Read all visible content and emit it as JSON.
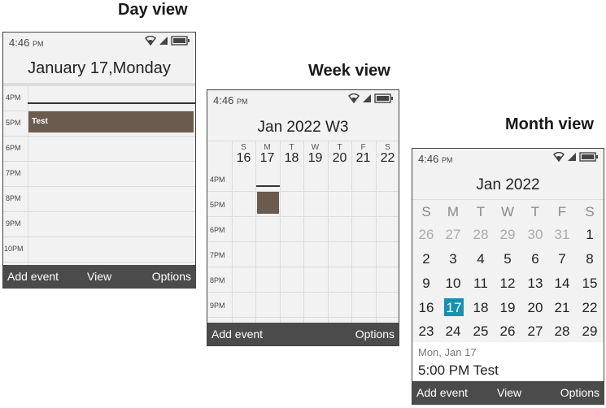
{
  "headings": {
    "day": "Day view",
    "week": "Week view",
    "month": "Month view"
  },
  "status": {
    "time": "4:46",
    "ampm": "PM"
  },
  "softkeys": {
    "add_event": "Add event",
    "view": "View",
    "options": "Options"
  },
  "day_view": {
    "title": "January 17,Monday",
    "hours": [
      "4PM",
      "5PM",
      "6PM",
      "7PM",
      "8PM",
      "9PM",
      "10PM"
    ],
    "event": {
      "title": "Test"
    }
  },
  "week_view": {
    "title": "Jan 2022 W3",
    "days": [
      {
        "letter": "S",
        "num": "16"
      },
      {
        "letter": "M",
        "num": "17"
      },
      {
        "letter": "T",
        "num": "18"
      },
      {
        "letter": "W",
        "num": "19"
      },
      {
        "letter": "T",
        "num": "20"
      },
      {
        "letter": "F",
        "num": "21"
      },
      {
        "letter": "S",
        "num": "22"
      }
    ],
    "hours": [
      "4PM",
      "5PM",
      "6PM",
      "7PM",
      "8PM",
      "9PM"
    ]
  },
  "month_view": {
    "title": "Jan 2022",
    "weekdays": [
      "S",
      "M",
      "T",
      "W",
      "T",
      "F",
      "S"
    ],
    "weeks": [
      [
        "26",
        "27",
        "28",
        "29",
        "30",
        "31",
        "1"
      ],
      [
        "2",
        "3",
        "4",
        "5",
        "6",
        "7",
        "8"
      ],
      [
        "9",
        "10",
        "11",
        "12",
        "13",
        "14",
        "15"
      ],
      [
        "16",
        "17",
        "18",
        "19",
        "20",
        "21",
        "22"
      ],
      [
        "23",
        "24",
        "25",
        "26",
        "27",
        "28",
        "29"
      ]
    ],
    "selected_date_label": "Mon, Jan 17",
    "agenda_item": "5:00 PM Test"
  },
  "colors": {
    "event": "#6b5b4f",
    "today": "#1691b4",
    "softkey_bar": "#4b4b4b"
  }
}
